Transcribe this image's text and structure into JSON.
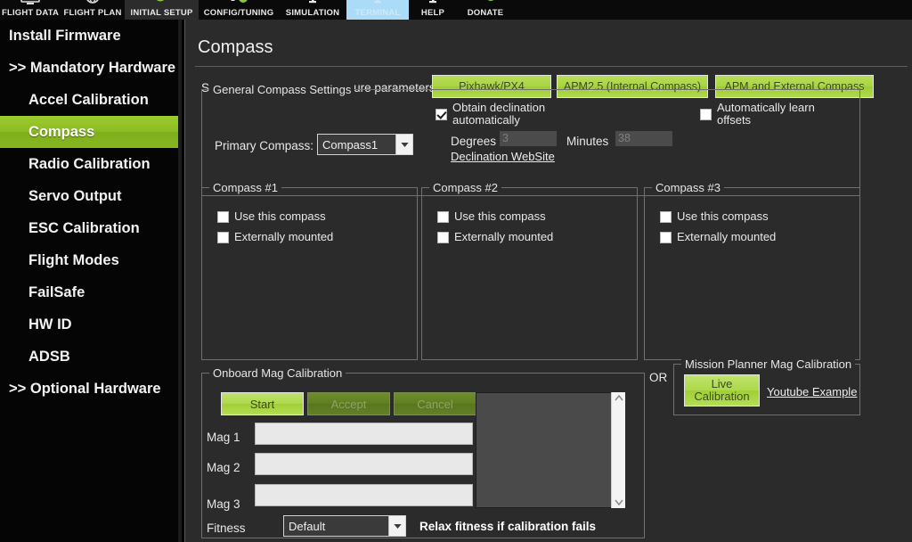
{
  "toolbar": {
    "items": [
      {
        "label": "FLIGHT DATA",
        "icon": "screen-icon",
        "state": "normal"
      },
      {
        "label": "FLIGHT PLAN",
        "icon": "globe-icon",
        "state": "normal"
      },
      {
        "label": "INITIAL SETUP",
        "icon": "gear-download-icon",
        "state": "shaded"
      },
      {
        "label": "CONFIG/TUNING",
        "icon": "wrench-gear-icon",
        "state": "normal"
      },
      {
        "label": "SIMULATION",
        "icon": "aircraft-icon",
        "state": "normal"
      },
      {
        "label": "TERMINAL",
        "icon": "aircraft-icon",
        "state": "active"
      },
      {
        "label": "HELP",
        "icon": "aircraft-icon",
        "state": "normal"
      },
      {
        "label": "DONATE",
        "icon": "heart-download-icon",
        "state": "normal"
      }
    ]
  },
  "sidebar": {
    "items": [
      {
        "label": "Install Firmware",
        "level": 0,
        "selected": false
      },
      {
        "label": ">> Mandatory Hardware",
        "level": 0,
        "selected": false
      },
      {
        "label": "Accel Calibration",
        "level": 1,
        "selected": false
      },
      {
        "label": "Compass",
        "level": 1,
        "selected": true
      },
      {
        "label": "Radio Calibration",
        "level": 1,
        "selected": false
      },
      {
        "label": "Servo Output",
        "level": 1,
        "selected": false
      },
      {
        "label": "ESC Calibration",
        "level": 1,
        "selected": false
      },
      {
        "label": "Flight Modes",
        "level": 1,
        "selected": false
      },
      {
        "label": "FailSafe",
        "level": 1,
        "selected": false
      },
      {
        "label": "HW ID",
        "level": 1,
        "selected": false
      },
      {
        "label": "ADSB",
        "level": 1,
        "selected": false
      },
      {
        "label": ">> Optional Hardware",
        "level": 0,
        "selected": false
      }
    ]
  },
  "page": {
    "title": "Compass"
  },
  "quick_config": {
    "label": "Select device to quick-configure parameters",
    "buttons": [
      {
        "label": "Pixhawk/PX4"
      },
      {
        "label": "APM2.5 (Internal Compass)"
      },
      {
        "label": "APM and External Compass"
      }
    ]
  },
  "general": {
    "group_label": "General Compass Settings",
    "primary_compass_label": "Primary Compass:",
    "primary_compass_value": "Compass1",
    "obtain_declination_label": "Obtain declination automatically",
    "obtain_declination_checked": true,
    "degrees_label": "Degrees",
    "degrees_value": "3",
    "minutes_label": "Minutes",
    "minutes_value": "38",
    "declination_link": "Declination WebSite",
    "auto_learn_label": "Automatically learn offsets",
    "auto_learn_checked": false
  },
  "compass_blocks": [
    {
      "group_label": "Compass #1",
      "use_label": "Use this compass",
      "use_checked": false,
      "ext_label": "Externally mounted",
      "ext_checked": false
    },
    {
      "group_label": "Compass #2",
      "use_label": "Use this compass",
      "use_checked": false,
      "ext_label": "Externally mounted",
      "ext_checked": false
    },
    {
      "group_label": "Compass #3",
      "use_label": "Use this compass",
      "use_checked": false,
      "ext_label": "Externally mounted",
      "ext_checked": false
    }
  ],
  "onboard": {
    "group_label": "Onboard Mag Calibration",
    "start_label": "Start",
    "accept_label": "Accept",
    "cancel_label": "Cancel",
    "start_enabled": true,
    "accept_enabled": false,
    "cancel_enabled": false,
    "mag_rows": [
      {
        "label": "Mag 1",
        "value": ""
      },
      {
        "label": "Mag 2",
        "value": ""
      },
      {
        "label": "Mag 3",
        "value": ""
      }
    ],
    "fitness_label": "Fitness",
    "fitness_value": "Default",
    "relax_note": "Relax fitness if calibration fails",
    "log_text": ""
  },
  "mp_calibration": {
    "or_label": "OR",
    "group_label": "Mission Planner Mag Calibration",
    "live_button_line1": "Live",
    "live_button_line2": "Calibration",
    "youtube_link": "Youtube Example"
  },
  "colors": {
    "accent_green": "#9ccd33",
    "selected_green": "#86b71f",
    "active_tab_blue": "#aadcf7",
    "panel_bg": "#2b2b2b",
    "sidebar_bg": "#050505"
  }
}
